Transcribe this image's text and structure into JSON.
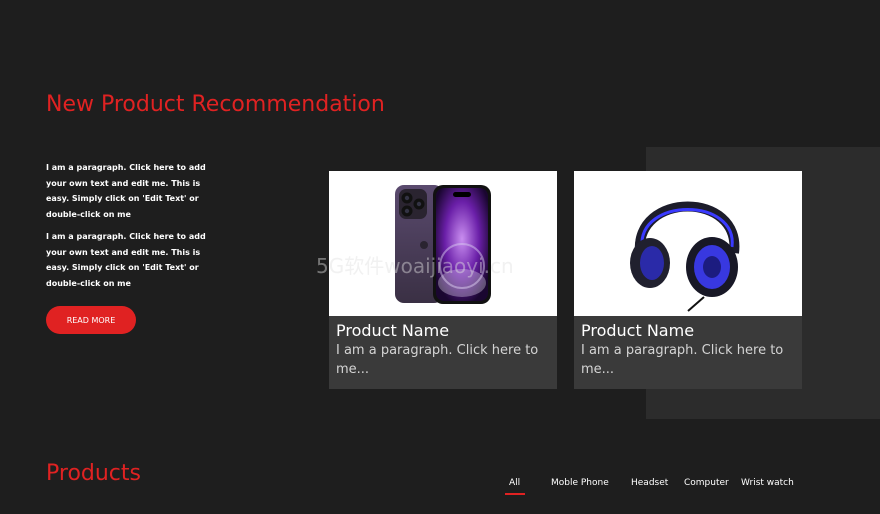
{
  "recommendation": {
    "title": "New Product Recommendation",
    "paragraph1": "I am a paragraph. Click here to add your own text and edit me. This is easy. Simply click on 'Edit Text' or double-click on me",
    "paragraph2": "I am a paragraph. Click here to add your own text and edit me. This is easy. Simply click on 'Edit Text' or double-click on me",
    "read_more": "READ MORE"
  },
  "cards": [
    {
      "name": "Product Name",
      "description": "I am a paragraph. Click here to me...",
      "image": "smartphone"
    },
    {
      "name": "Product Name",
      "description": "I am a paragraph. Click here to me...",
      "image": "headset"
    }
  ],
  "watermark": "5G软件woaijiaoyi.cn",
  "products": {
    "title": "Products",
    "tabs": [
      "All",
      "Moble Phone",
      "Headset",
      "Computer",
      "Wrist watch"
    ],
    "active_tab": "All"
  },
  "colors": {
    "accent": "#e02222",
    "background": "#1e1e1e",
    "card": "#3a3a3a",
    "panel": "#2c2c2c"
  }
}
